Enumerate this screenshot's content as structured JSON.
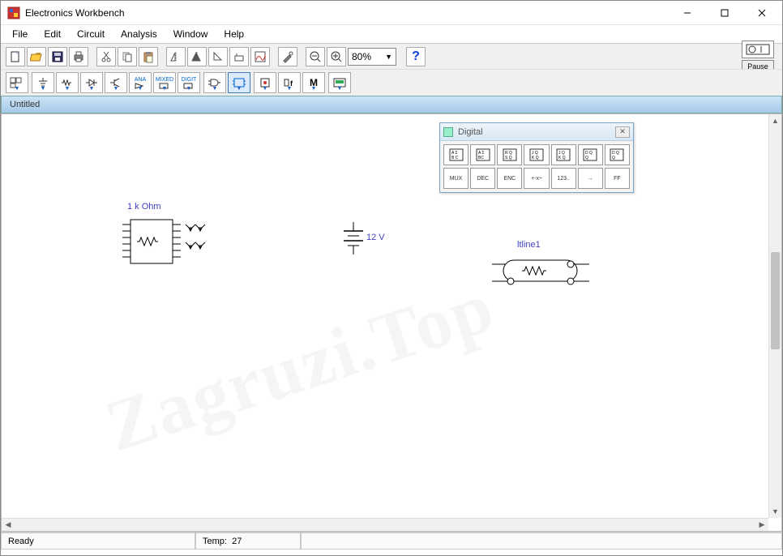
{
  "app": {
    "title": "Electronics Workbench"
  },
  "menu": {
    "file": "File",
    "edit": "Edit",
    "circuit": "Circuit",
    "analysis": "Analysis",
    "window": "Window",
    "help": "Help"
  },
  "toolbar1": {
    "zoom": "80%",
    "help": "?",
    "pause": "Pause"
  },
  "document": {
    "title": "Untitled"
  },
  "palette": {
    "title": "Digital",
    "row2": [
      "MUX",
      "DEC",
      "ENC",
      "+-x÷",
      "123..",
      "→",
      "FF"
    ]
  },
  "components": {
    "resistor_label": "1 k Ohm",
    "battery_label": "12 V",
    "tline_label": "ltline1"
  },
  "status": {
    "ready": "Ready",
    "temp_label": "Temp:",
    "temp_value": "27"
  }
}
